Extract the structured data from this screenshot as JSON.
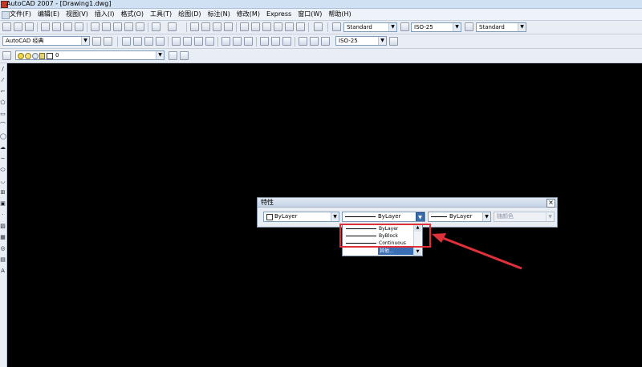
{
  "window": {
    "title": "AutoCAD 2007 - [Drawing1.dwg]"
  },
  "menu": [
    "文件(F)",
    "编辑(E)",
    "视图(V)",
    "插入(I)",
    "格式(O)",
    "工具(T)",
    "绘图(D)",
    "标注(N)",
    "修改(M)",
    "Express",
    "窗口(W)",
    "帮助(H)"
  ],
  "toolbar1": {
    "text_style": "Standard",
    "dim_style": "ISO-25",
    "table_style": "Standard"
  },
  "toolbar2": {
    "workspace": "AutoCAD 经典",
    "dim_style": "ISO-25"
  },
  "toolbar3": {
    "layer": "0"
  },
  "properties_panel": {
    "title": "特性",
    "close": "×",
    "color": "ByLayer",
    "linetype": "ByLayer",
    "lineweight": "ByLayer",
    "plotstyle": "随颜色"
  },
  "linetype_dropdown": {
    "options": [
      "ByLayer",
      "ByBlock",
      "Continuous"
    ],
    "selected_other": "其他..."
  },
  "colors": {
    "canvas": "#000000",
    "highlight_box": "#e0303a",
    "arrow": "#e0303a",
    "selection": "#3a6fb5"
  },
  "icons": {
    "sysmenu": "autocad-icon",
    "close": "close-icon",
    "dropdown_arrow": "chevron-down-icon"
  }
}
